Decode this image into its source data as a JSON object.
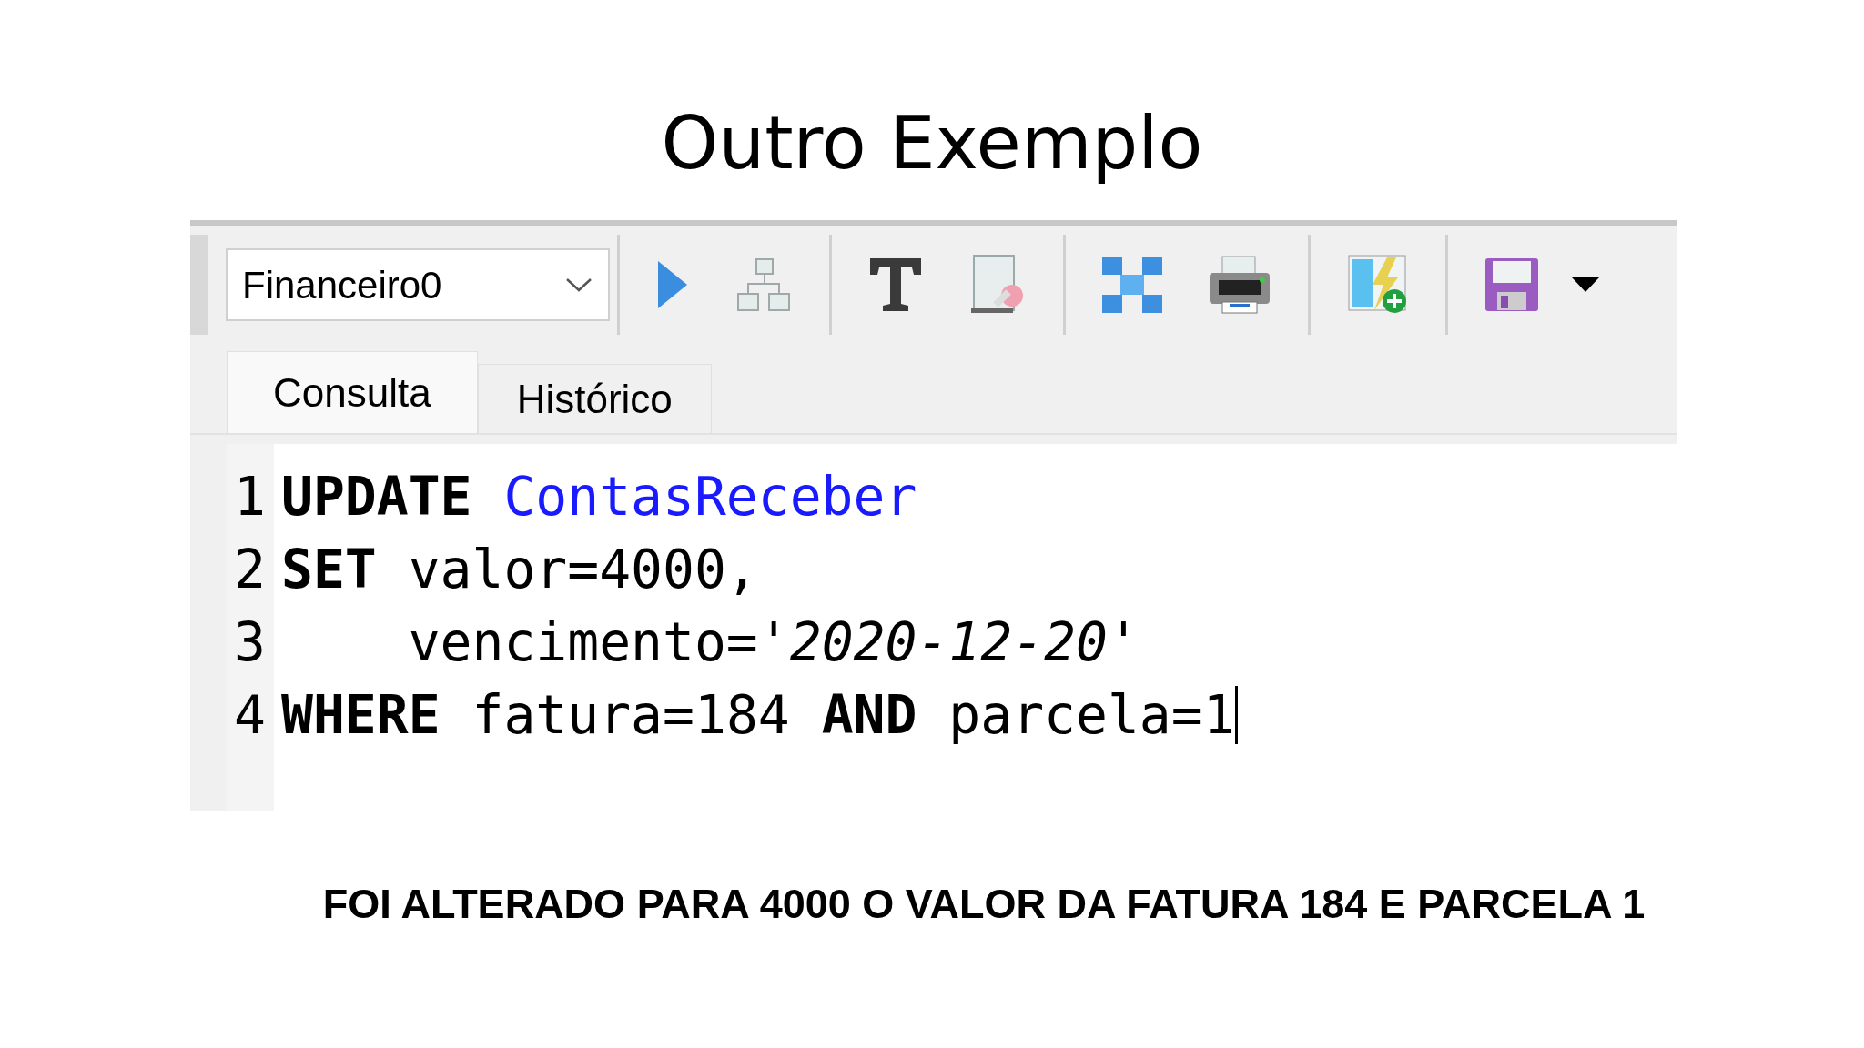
{
  "slide_title": "Outro Exemplo",
  "toolbar": {
    "database": "Financeiro0"
  },
  "tabs": [
    {
      "label": "Consulta",
      "selected": true
    },
    {
      "label": "Histórico",
      "selected": false
    }
  ],
  "editor": {
    "lines": [
      {
        "number": "1",
        "cursor": false,
        "tokens": [
          {
            "kind": "keyword",
            "text": "UPDATE"
          },
          {
            "kind": "table",
            "text": " ContasReceber"
          }
        ]
      },
      {
        "number": "2",
        "cursor": false,
        "tokens": [
          {
            "kind": "keyword",
            "text": "SET"
          },
          {
            "kind": "plain",
            "text": " valor=4000,"
          }
        ]
      },
      {
        "number": "3",
        "cursor": false,
        "tokens": [
          {
            "kind": "plain",
            "text": "    vencimento="
          },
          {
            "kind": "string",
            "text": "'2020-12-20'"
          }
        ]
      },
      {
        "number": "4",
        "cursor": true,
        "tokens": [
          {
            "kind": "keyword",
            "text": "WHERE"
          },
          {
            "kind": "plain",
            "text": " fatura=184 "
          },
          {
            "kind": "keyword",
            "text": "AND"
          },
          {
            "kind": "plain",
            "text": " parcela=1"
          }
        ]
      }
    ]
  },
  "caption": "FOI ALTERADO PARA 4000 O VALOR DA FATURA 184 E PARCELA 1"
}
